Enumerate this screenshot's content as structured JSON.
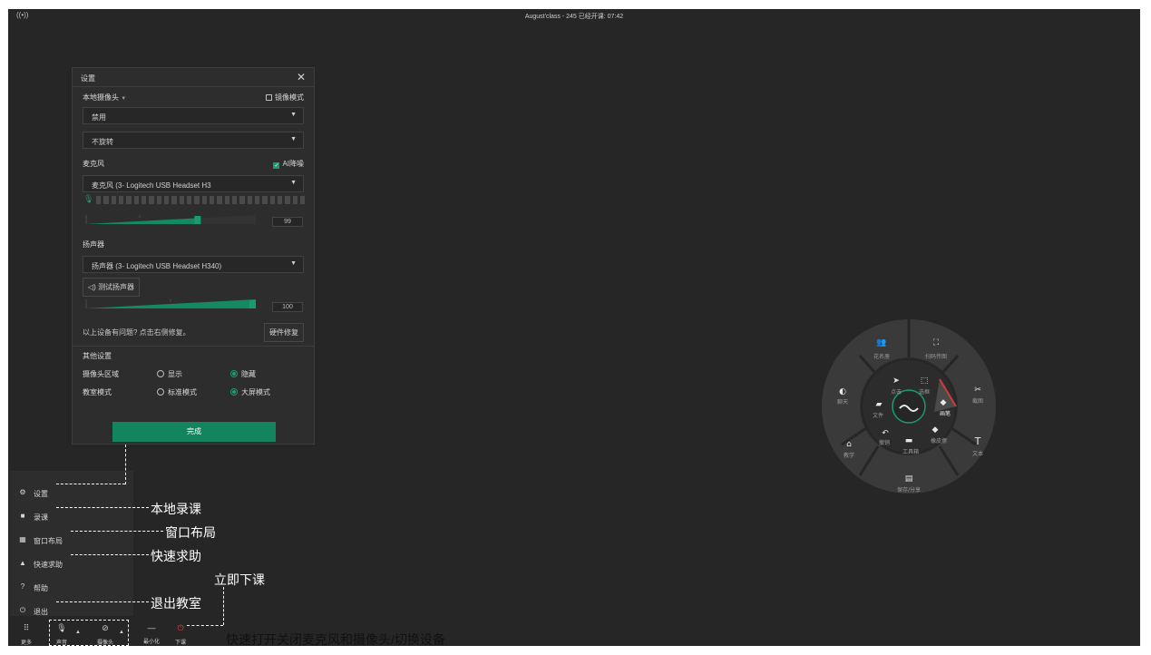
{
  "topbar": {
    "signal_icon": "((•))",
    "title": "August'class - 245   已经开课: 07:42"
  },
  "settings": {
    "title": "设置",
    "close": "✕",
    "camera_label": "本地摄像头",
    "mirror_label": "镜像模式",
    "camera_value": "禁用",
    "rotate_value": "不旋转",
    "mic_label": "麦克风",
    "ai_noise_label": "AI降噪",
    "mic_device": "麦克风 (3- Logitech USB Headset H3",
    "mic_volume": "99",
    "mic_volume_level": 0.66,
    "speaker_label": "扬声器",
    "speaker_device": "扬声器 (3- Logitech USB Headset H340)",
    "test_speaker": "测试扬声器",
    "speaker_volume": "100",
    "speaker_volume_level": 1.0,
    "issue_hint": "以上设备有问题? 点击右侧修复。",
    "repair_button": "硬件修复",
    "other_label": "其他设置",
    "camera_area_label": "摄像头区域",
    "show_option": "显示",
    "hide_option": "隐藏",
    "class_mode_label": "教室模式",
    "standard_mode": "标准模式",
    "big_mode": "大屏模式",
    "done_button": "完成"
  },
  "menu": {
    "items": [
      {
        "icon": "gear-icon",
        "glyph": "⚙",
        "label": "设置"
      },
      {
        "icon": "camera-icon",
        "glyph": "■",
        "label": "录课"
      },
      {
        "icon": "layout-icon",
        "glyph": "▦",
        "label": "窗口布局"
      },
      {
        "icon": "bell-icon",
        "glyph": "▲",
        "label": "快速求助"
      },
      {
        "icon": "help-icon",
        "glyph": "?",
        "label": "帮助"
      },
      {
        "icon": "power-icon",
        "glyph": "⏻",
        "label": "退出"
      }
    ]
  },
  "toolbar": {
    "more": "更多",
    "mic": "声音",
    "camera": "摄像头",
    "minimize": "最小化",
    "leave": "下课"
  },
  "annotations": {
    "record": "本地录课",
    "layout": "窗口布局",
    "help": "快速求助",
    "leave_now": "立即下课",
    "exit": "退出教室",
    "toggle": "快速打开关闭麦克风和摄像头/切换设备"
  },
  "radial_menu": {
    "outer": [
      "花名册",
      "扫码传图",
      "截图",
      "文本",
      "保存/分享",
      "教学",
      "聊天"
    ],
    "inner": [
      "点击",
      "选框",
      "画笔",
      "橡皮擦",
      "工具箱",
      "撤销",
      "文件"
    ],
    "accent": "#d33a3a"
  },
  "colors": {
    "accent": "#12845e",
    "background": "#262626",
    "panel": "#2d2d2d"
  }
}
